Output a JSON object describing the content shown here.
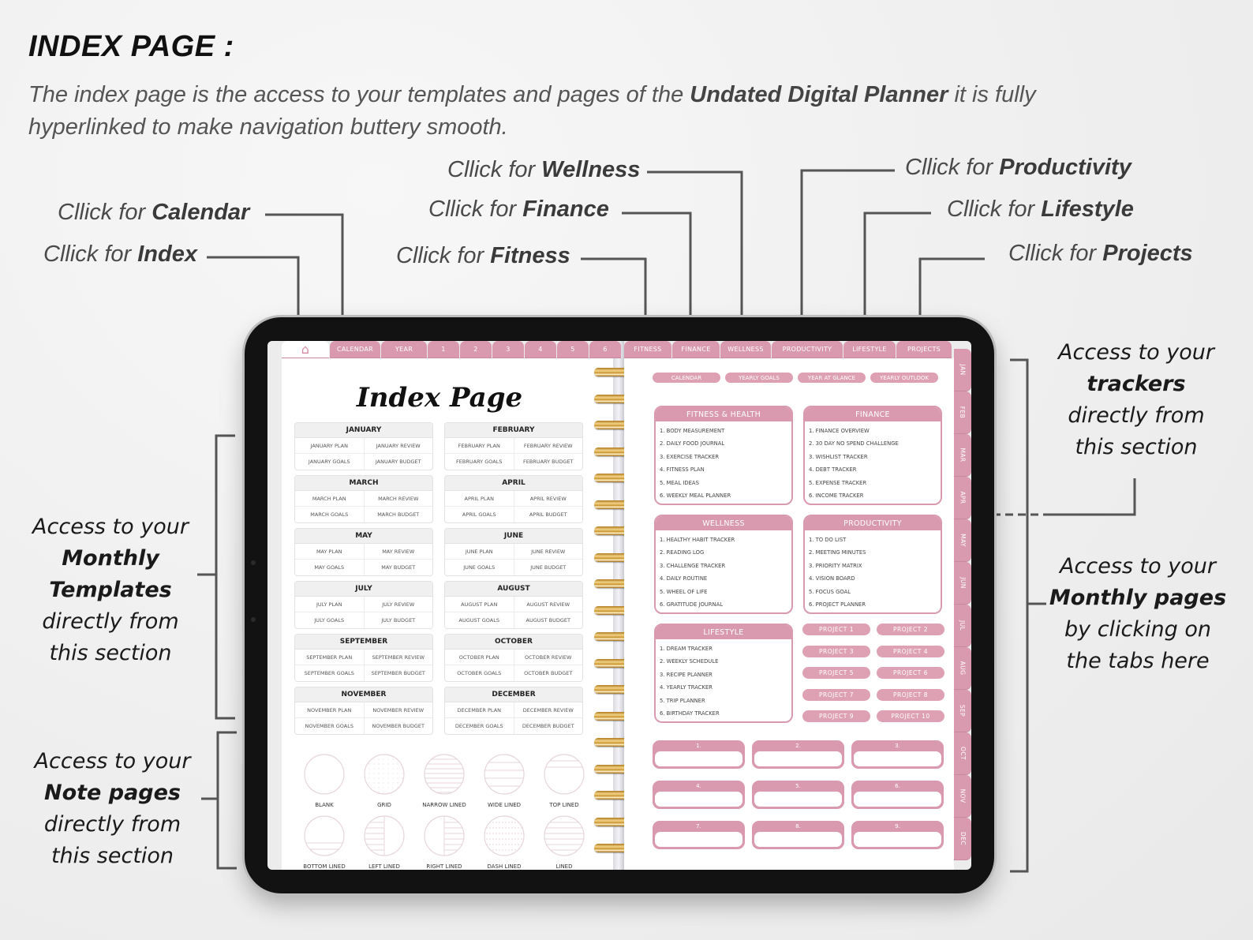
{
  "header": {
    "title": "INDEX PAGE :",
    "intro_pre": "The index page is the access to your templates and pages of the ",
    "intro_bold": "Undated Digital Planner",
    "intro_post": " it is fully hyperlinked to make navigation buttery smooth."
  },
  "callouts": {
    "prefix": "Cllick for ",
    "index": "Index",
    "calendar": "Calendar",
    "fitness": "Fitness",
    "finance": "Finance",
    "wellness": "Wellness",
    "productivity": "Productivity",
    "lifestyle": "Lifestyle",
    "projects": "Projects"
  },
  "side_notes": {
    "monthly_templates": {
      "l1": "Access to your",
      "b1": "Monthly",
      "b2": "Templates",
      "l2": "directly from",
      "l3": "this section"
    },
    "note_pages": {
      "l1": "Access to your",
      "b1": "Note pages",
      "l2": "directly from",
      "l3": "this section"
    },
    "trackers": {
      "l1": "Access to your",
      "b1": "trackers",
      "l2": "directly from",
      "l3": "this section"
    },
    "monthly_pages": {
      "l1": "Access to your",
      "b1": "Monthly pages",
      "l2": "by clicking on",
      "l3": "the tabs here"
    }
  },
  "planner": {
    "top_tabs_left": [
      "CALENDAR",
      "YEAR",
      "1",
      "2",
      "3",
      "4",
      "5",
      "6"
    ],
    "top_tabs_right": [
      "FITNESS",
      "FINANCE",
      "WELLNESS",
      "PRODUCTIVITY",
      "LIFESTYLE",
      "PROJECTS"
    ],
    "home_icon": "home-icon",
    "index_heading": "Index Page",
    "months": [
      {
        "name": "JANUARY",
        "cells": [
          "JANUARY PLAN",
          "JANUARY REVIEW",
          "JANUARY GOALS",
          "JANUARY BUDGET"
        ]
      },
      {
        "name": "FEBRUARY",
        "cells": [
          "FEBRUARY PLAN",
          "FEBRUARY REVIEW",
          "FEBRUARY GOALS",
          "FEBRUARY BUDGET"
        ]
      },
      {
        "name": "MARCH",
        "cells": [
          "MARCH PLAN",
          "MARCH REVIEW",
          "MARCH GOALS",
          "MARCH BUDGET"
        ]
      },
      {
        "name": "APRIL",
        "cells": [
          "APRIL PLAN",
          "APRIL REVIEW",
          "APRIL GOALS",
          "APRIL BUDGET"
        ]
      },
      {
        "name": "MAY",
        "cells": [
          "MAY PLAN",
          "MAY REVIEW",
          "MAY GOALS",
          "MAY BUDGET"
        ]
      },
      {
        "name": "JUNE",
        "cells": [
          "JUNE PLAN",
          "JUNE REVIEW",
          "JUNE GOALS",
          "JUNE BUDGET"
        ]
      },
      {
        "name": "JULY",
        "cells": [
          "JULY PLAN",
          "JULY REVIEW",
          "JULY GOALS",
          "JULY BUDGET"
        ]
      },
      {
        "name": "AUGUST",
        "cells": [
          "AUGUST PLAN",
          "AUGUST REVIEW",
          "AUGUST GOALS",
          "AUGUST BUDGET"
        ]
      },
      {
        "name": "SEPTEMBER",
        "cells": [
          "SEPTEMBER PLAN",
          "SEPTEMBER REVIEW",
          "SEPTEMBER GOALS",
          "SEPTEMBER BUDGET"
        ]
      },
      {
        "name": "OCTOBER",
        "cells": [
          "OCTOBER PLAN",
          "OCTOBER REVIEW",
          "OCTOBER GOALS",
          "OCTOBER BUDGET"
        ]
      },
      {
        "name": "NOVEMBER",
        "cells": [
          "NOVEMBER PLAN",
          "NOVEMBER REVIEW",
          "NOVEMBER GOALS",
          "NOVEMBER BUDGET"
        ]
      },
      {
        "name": "DECEMBER",
        "cells": [
          "DECEMBER PLAN",
          "DECEMBER REVIEW",
          "DECEMBER GOALS",
          "DECEMBER BUDGET"
        ]
      }
    ],
    "note_pages": [
      {
        "label": "BLANK",
        "style": "blank"
      },
      {
        "label": "GRID",
        "style": "grid"
      },
      {
        "label": "NARROW LINED",
        "style": "narrow"
      },
      {
        "label": "WIDE LINED",
        "style": "wide"
      },
      {
        "label": "TOP LINED",
        "style": "top"
      },
      {
        "label": "BOTTOM LINED",
        "style": "bottom"
      },
      {
        "label": "LEFT LINED",
        "style": "left"
      },
      {
        "label": "RIGHT LINED",
        "style": "right"
      },
      {
        "label": "DASH LINED",
        "style": "dash"
      },
      {
        "label": "LINED",
        "style": "lined"
      }
    ],
    "quick_links": [
      "CALENDAR",
      "YEARLY GOALS",
      "YEAR AT GLANCE",
      "YEARLY OUTLOOK"
    ],
    "trackers": [
      {
        "title": "FITNESS & HEALTH",
        "items": [
          "1. BODY MEASUREMENT",
          "2. DAILY FOOD JOURNAL",
          "3. EXERCISE TRACKER",
          "4. FITNESS PLAN",
          "5. MEAL IDEAS",
          "6. WEEKLY MEAL PLANNER"
        ]
      },
      {
        "title": "FINANCE",
        "items": [
          "1. FINANCE OVERVIEW",
          "2. 30 DAY NO SPEND CHALLENGE",
          "3. WISHLIST TRACKER",
          "4. DEBT TRACKER",
          "5. EXPENSE TRACKER",
          "6. INCOME TRACKER"
        ]
      },
      {
        "title": "WELLNESS",
        "items": [
          "1. HEALTHY HABIT TRACKER",
          "2. READING LOG",
          "3. CHALLENGE TRACKER",
          "4. DAILY ROUTINE",
          "5. WHEEL OF LIFE",
          "6. GRATITUDE JOURNAL"
        ]
      },
      {
        "title": "PRODUCTIVITY",
        "items": [
          "1. TO DO LIST",
          "2. MEETING MINUTES",
          "3. PRIORITY MATRIX",
          "4. VISION BOARD",
          "5. FOCUS GOAL",
          "6. PROJECT PLANNER"
        ]
      },
      {
        "title": "LIFESTYLE",
        "items": [
          "1. DREAM TRACKER",
          "2. WEEKLY SCHEDULE",
          "3. RECIPE PLANNER",
          "4. YEARLY TRACKER",
          "5. TRIP PLANNER",
          "6. BIRTHDAY TRACKER"
        ]
      }
    ],
    "projects": [
      "PROJECT 1",
      "PROJECT 2",
      "PROJECT 3",
      "PROJECT 4",
      "PROJECT 5",
      "PROJECT 6",
      "PROJECT 7",
      "PROJECT 8",
      "PROJECT 9",
      "PROJECT 10"
    ],
    "numbered_boxes": [
      "1.",
      "2.",
      "3.",
      "4.",
      "5.",
      "6.",
      "7.",
      "8.",
      "9."
    ],
    "side_tabs": [
      "JAN",
      "FEB",
      "MAR",
      "APR",
      "MAY",
      "JUN",
      "JUL",
      "AUG",
      "SEP",
      "OCT",
      "NOV",
      "DEC"
    ]
  },
  "colors": {
    "accent_pink": "#d99ab0",
    "ring_gold": "#d9a640",
    "text_dark": "#111111"
  }
}
